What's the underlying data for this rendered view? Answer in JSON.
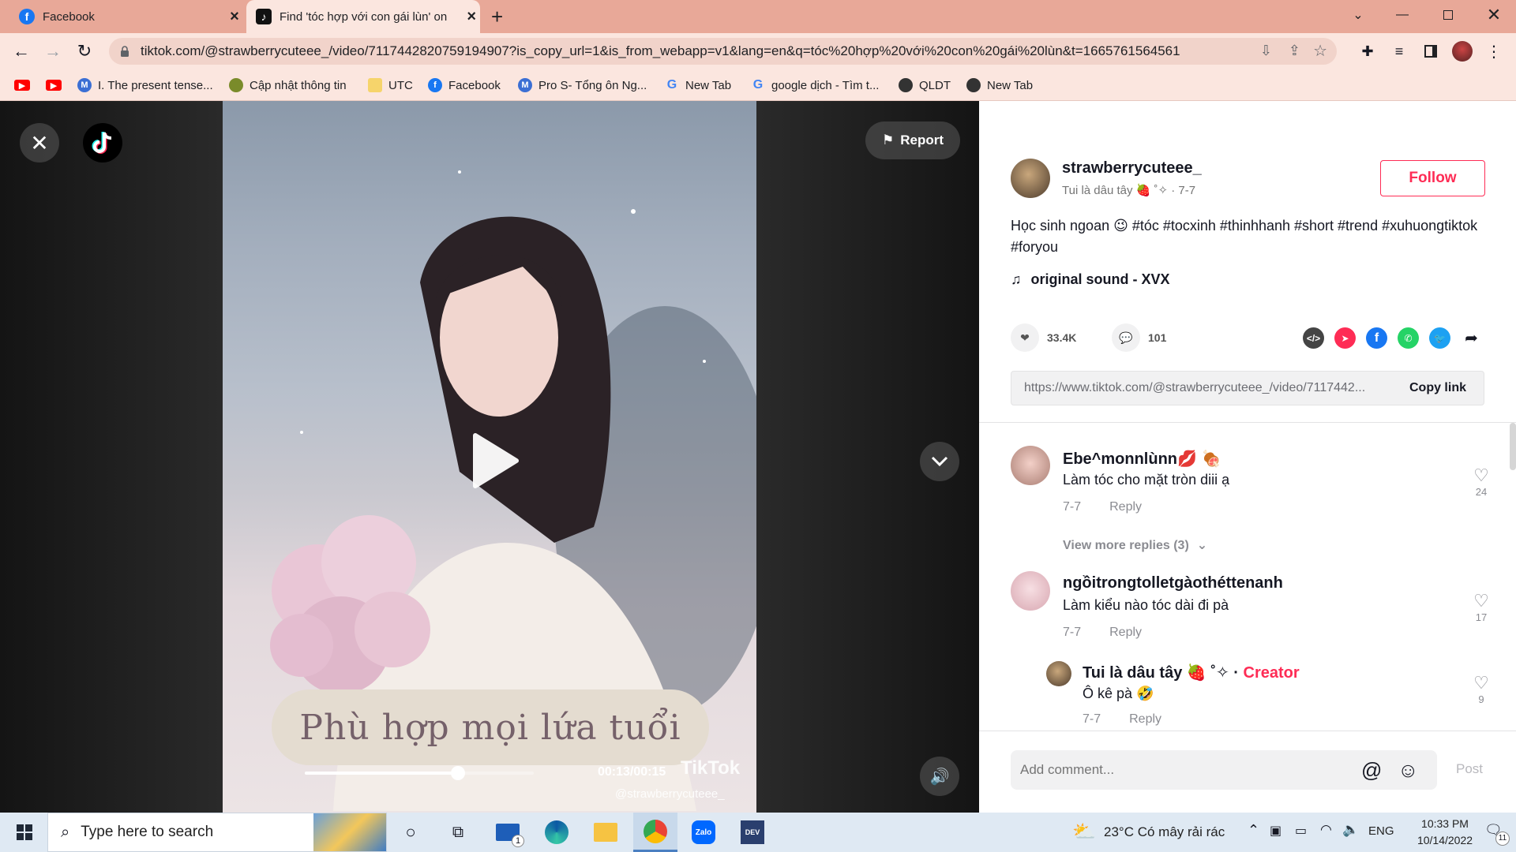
{
  "browser": {
    "tabs": [
      {
        "title": "Facebook",
        "active": false,
        "icon": "facebook-icon"
      },
      {
        "title": "Find 'tóc hợp với con gái lùn' on",
        "active": true,
        "icon": "tiktok-icon"
      }
    ],
    "new_tab": "+",
    "url": "tiktok.com/@strawberrycuteee_/video/7117442820759194907?is_copy_url=1&is_from_webapp=v1&lang=en&q=tóc%20hợp%20với%20con%20gái%20lùn&t=1665761564561",
    "bookmarks": [
      {
        "label": "",
        "icon": "youtube-icon"
      },
      {
        "label": "",
        "icon": "youtube-icon"
      },
      {
        "label": "I. The present tense...",
        "icon": "m-icon"
      },
      {
        "label": "Cập nhật thông tin",
        "icon": "globe-icon"
      },
      {
        "label": "UTC",
        "icon": "folder-icon"
      },
      {
        "label": "Facebook",
        "icon": "facebook-icon"
      },
      {
        "label": "Pro S- Tổng ôn Ng...",
        "icon": "m-icon"
      },
      {
        "label": "New Tab",
        "icon": "google-icon"
      },
      {
        "label": "google dịch - Tìm t...",
        "icon": "google-icon"
      },
      {
        "label": "QLDT",
        "icon": "globe-icon"
      },
      {
        "label": "New Tab",
        "icon": "globe-icon"
      }
    ]
  },
  "viewer": {
    "report": "Report",
    "caption": "Phù hợp mọi lứa tuổi",
    "time": "00:13/00:15",
    "progress": 0.67,
    "watermark": "TikTok",
    "watermark_user": "@strawberrycuteee_"
  },
  "post": {
    "username": "strawberrycuteee_",
    "nickname": "Tui là dâu tây 🍓 ˚✧",
    "date": "7-7",
    "follow": "Follow",
    "description": "Học sinh ngoan 😉 #tóc #tocxinh #thinhhanh #short #trend #xuhuongtiktok #foryou",
    "music": "original sound - XVX",
    "likes": "33.4K",
    "comments": "101",
    "link": "https://www.tiktok.com/@strawberrycuteee_/video/7117442...",
    "copy_link": "Copy link"
  },
  "comments": [
    {
      "name": "Ebe^monnlùnn💋 🍖",
      "text": "Làm tóc cho mặt tròn diii ạ",
      "date": "7-7",
      "reply": "Reply",
      "likes": "24",
      "more": "View more replies (3)"
    },
    {
      "name": "ngồitrongtolletgàothéttenanh",
      "text": "Làm kiểu nào tóc dài đi pà",
      "date": "7-7",
      "reply": "Reply",
      "likes": "17"
    },
    {
      "name": "Tui là dâu tây 🍓 ˚✧ ·",
      "creator": "Creator",
      "text": "Ô kê pà 🤣",
      "date": "7-7",
      "reply": "Reply",
      "likes": "9"
    }
  ],
  "composer": {
    "placeholder": "Add comment...",
    "post": "Post"
  },
  "taskbar": {
    "search": "Type here to search",
    "weather": "23°C  Có mây rải rác",
    "lang": "ENG",
    "time": "10:33 PM",
    "date": "10/14/2022",
    "notif": "11",
    "mail_badge": "1"
  },
  "colors": {
    "accent": "#fe2c55",
    "tabbar": "#e8a898",
    "toolbar": "#fbe6df"
  }
}
